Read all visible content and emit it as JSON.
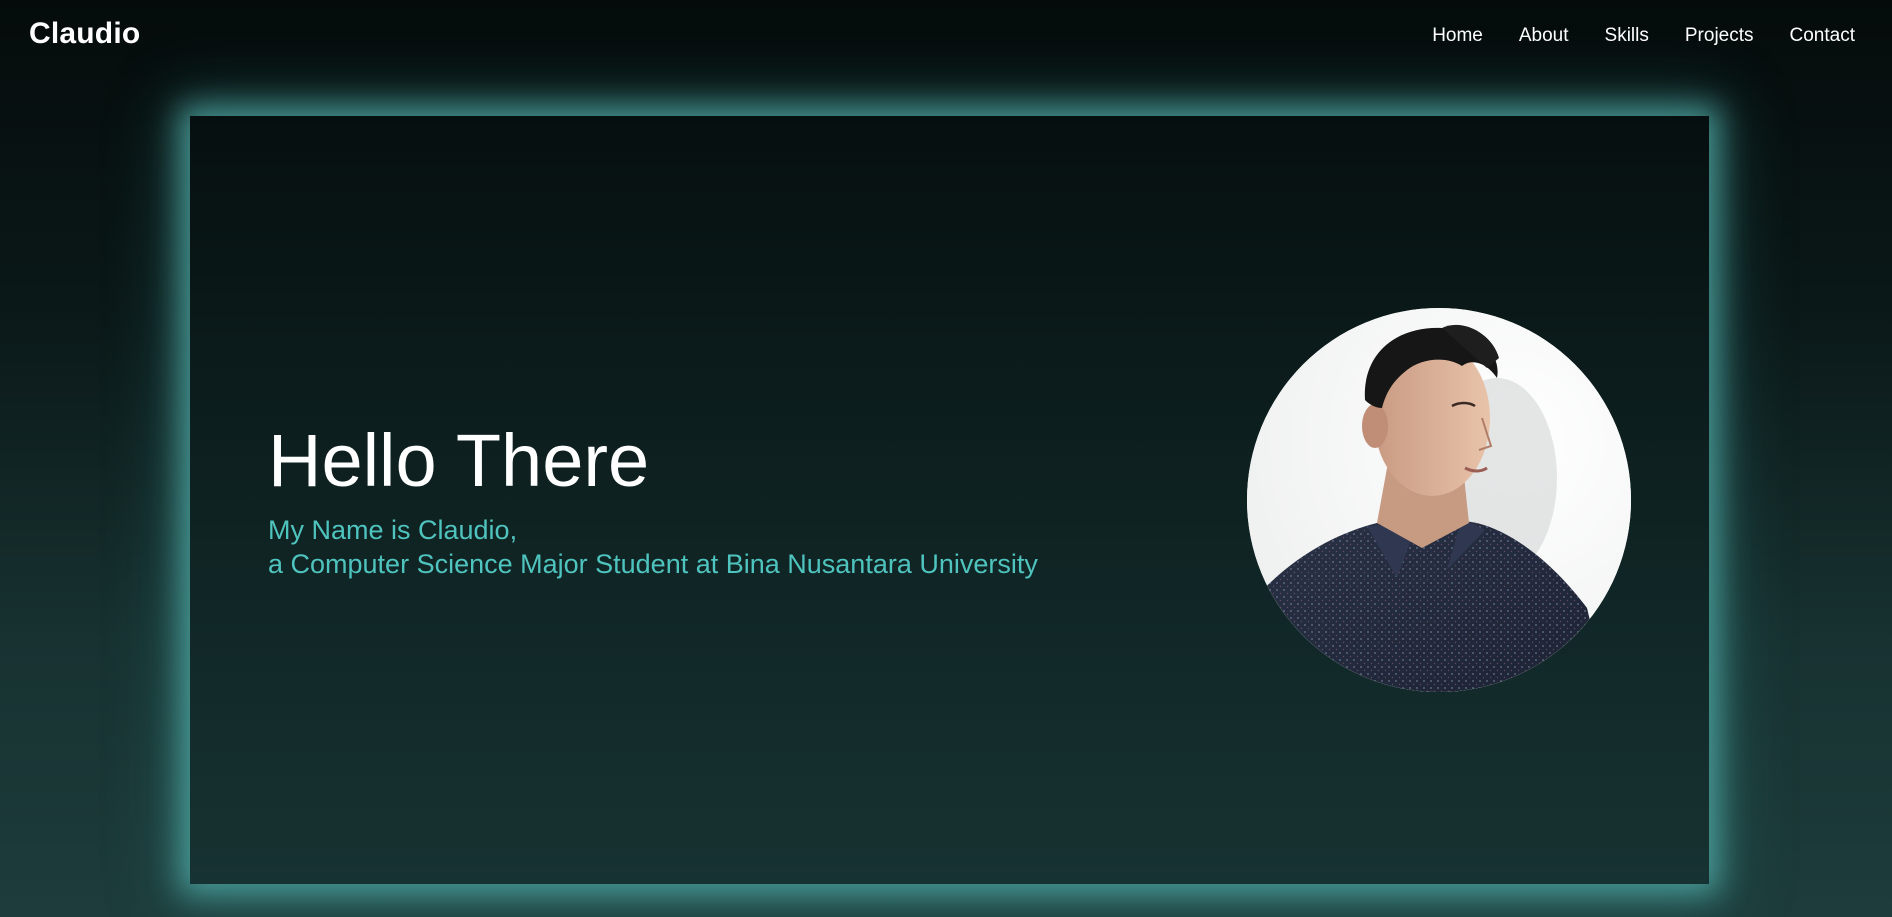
{
  "navbar": {
    "brand": "Claudio",
    "links": [
      {
        "label": "Home"
      },
      {
        "label": "About"
      },
      {
        "label": "Skills"
      },
      {
        "label": "Projects"
      },
      {
        "label": "Contact"
      }
    ]
  },
  "hero": {
    "title": "Hello There",
    "subtitle_line1": "My Name is Claudio,",
    "subtitle_line2": "a Computer Science Major Student at Bina Nusantara University"
  },
  "colors": {
    "accent": "#4fc3bd",
    "background_dark": "#050b0b",
    "glow": "#54b2ae"
  }
}
